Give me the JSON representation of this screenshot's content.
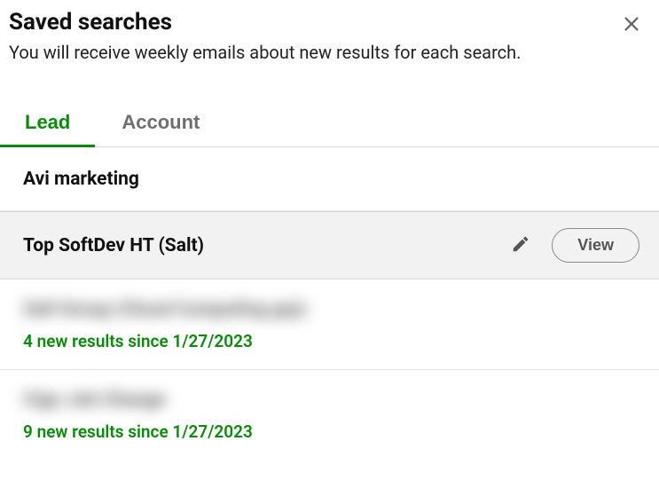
{
  "header": {
    "title": "Saved searches",
    "subtitle": "You will receive weekly emails about new results for each search."
  },
  "tabs": {
    "lead": "Lead",
    "account": "Account"
  },
  "rows": {
    "r0": {
      "title": "Avi marketing"
    },
    "r1": {
      "title": "Top SoftDev HT (Salt)",
      "view": "View"
    },
    "r2": {
      "title": "Salt Group (Cloud Computing grp)",
      "sub": "4 new results since 1/27/2023"
    },
    "r3": {
      "title": "Cigo Job Change",
      "sub": "9 new results since 1/27/2023"
    }
  }
}
